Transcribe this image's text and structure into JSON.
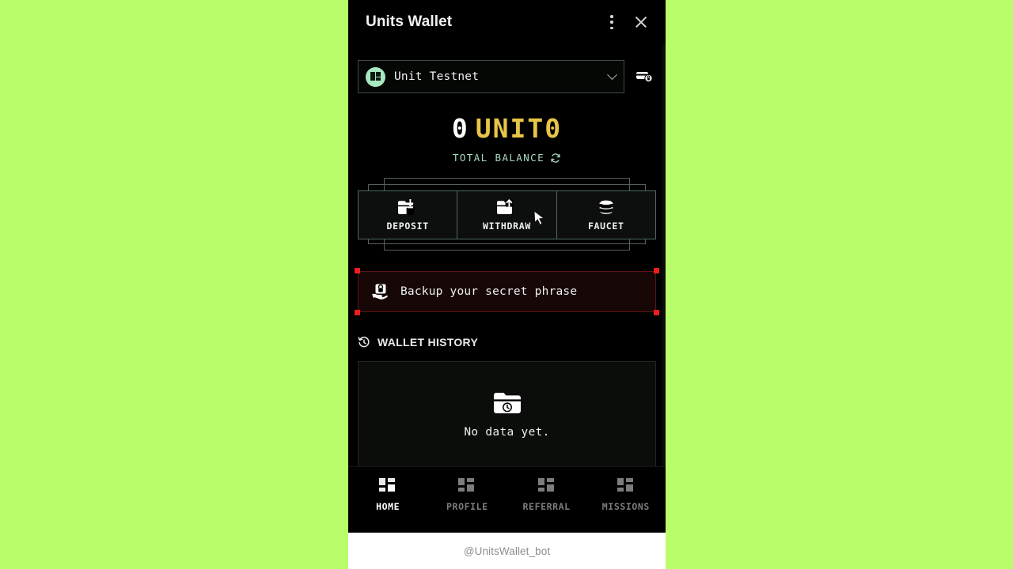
{
  "background_color": "#bafd6a",
  "header": {
    "title": "Units Wallet",
    "menu_icon": "more-vertical-icon",
    "close_icon": "close-icon"
  },
  "network": {
    "selected": "Unit Testnet",
    "logo_icon": "unit-logo-icon",
    "chevron_icon": "chevron-down-icon",
    "card_lock_icon": "card-lock-icon"
  },
  "balance": {
    "amount": "0",
    "ticker": "UNIT0",
    "label": "TOTAL BALANCE",
    "refresh_icon": "refresh-icon",
    "amount_color": "#ffffff",
    "ticker_color": "#e8c547",
    "label_color": "#a9dcc0"
  },
  "actions": [
    {
      "label": "DEPOSIT",
      "icon": "folder-download-icon"
    },
    {
      "label": "WITHDRAW",
      "icon": "folder-upload-icon"
    },
    {
      "label": "FAUCET",
      "icon": "coins-stack-icon"
    }
  ],
  "backup_banner": {
    "text": "Backup your secret phrase",
    "icon": "hand-lock-icon",
    "accent_color": "#ef1d1d"
  },
  "history": {
    "title": "WALLET HISTORY",
    "icon": "history-clock-icon",
    "empty_text": "No data yet.",
    "empty_icon": "folder-clock-icon"
  },
  "bottom_nav": {
    "items": [
      {
        "label": "HOME",
        "icon": "dashboard-icon",
        "active": true
      },
      {
        "label": "PROFILE",
        "icon": "dashboard-icon",
        "active": false
      },
      {
        "label": "REFERRAL",
        "icon": "dashboard-icon",
        "active": false
      },
      {
        "label": "MISSIONS",
        "icon": "dashboard-icon",
        "active": false
      }
    ]
  },
  "footer": {
    "handle": "@UnitsWallet_bot"
  }
}
